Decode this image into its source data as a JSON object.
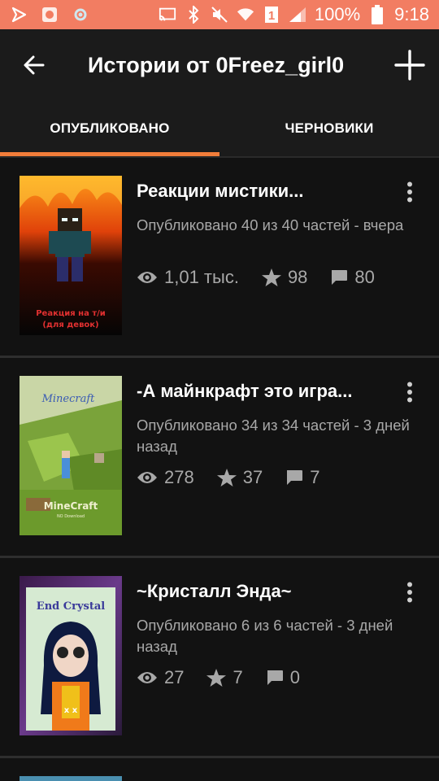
{
  "status_bar": {
    "battery_percent": "100%",
    "time": "9:18",
    "sim_badge": "1"
  },
  "app_bar": {
    "title": "Истории от 0Freez_girl0"
  },
  "tabs": [
    {
      "label": "ОПУБЛИКОВАНО",
      "active": true
    },
    {
      "label": "ЧЕРНОВИКИ",
      "active": false
    }
  ],
  "stories": [
    {
      "title": "Реакции мистики...",
      "meta": "Опубликовано 40 из 40 частей - вчера",
      "views": "1,01 тыс.",
      "votes": "98",
      "comments": "80",
      "cover_caption": "Реакция на т/и (для девок)"
    },
    {
      "title": "-А майнкрафт это игра...",
      "meta": "Опубликовано 34 из 34 частей - 3 дней назад",
      "views": "278",
      "votes": "37",
      "comments": "7",
      "cover_caption": "MineCraft"
    },
    {
      "title": "~Кристалл Энда~",
      "meta": "Опубликовано 6 из 6 частей - 3 дней назад",
      "views": "27",
      "votes": "7",
      "comments": "0",
      "cover_caption": "End Crystal"
    }
  ],
  "colors": {
    "status_bar": "#f27d62",
    "accent": "#f27d3a",
    "background": "#121212",
    "app_bar": "#1b1b1b",
    "secondary_text": "#a8a8a8"
  }
}
